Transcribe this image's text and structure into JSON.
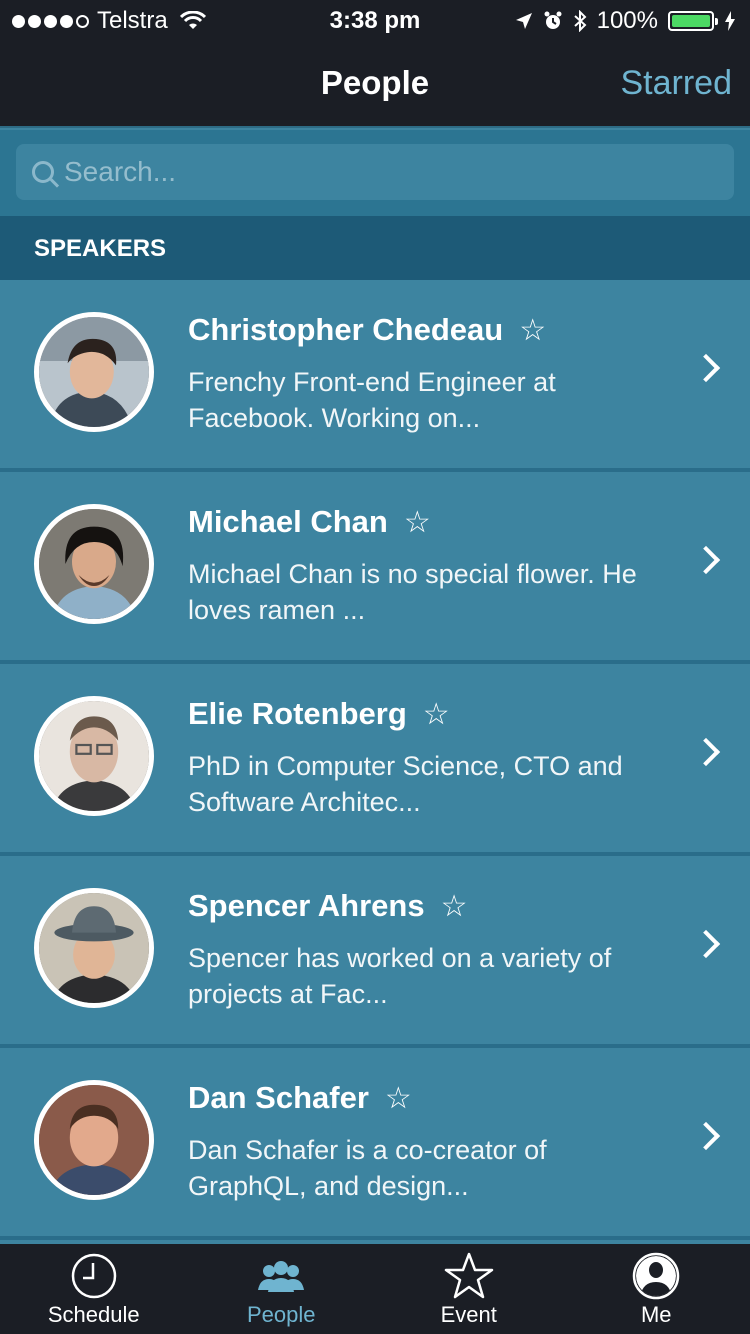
{
  "status": {
    "carrier": "Telstra",
    "time": "3:38 pm",
    "battery": "100%",
    "battery_level": 1.0
  },
  "nav": {
    "title": "People",
    "right_action": "Starred"
  },
  "search": {
    "placeholder": "Search..."
  },
  "section": {
    "title": "SPEAKERS"
  },
  "speakers": [
    {
      "name": "Christopher Chedeau",
      "bio": "Frenchy Front-end Engineer at Facebook. Working on...",
      "starred": false
    },
    {
      "name": "Michael Chan",
      "bio": "Michael Chan is no special flower. He loves ramen ...",
      "starred": false
    },
    {
      "name": "Elie Rotenberg",
      "bio": "PhD in Computer Science, CTO and Software Architec...",
      "starred": false
    },
    {
      "name": "Spencer Ahrens",
      "bio": "Spencer has worked on a variety of projects at Fac...",
      "starred": false
    },
    {
      "name": "Dan Schafer",
      "bio": "Dan Schafer is a co-creator of GraphQL, and design...",
      "starred": false
    }
  ],
  "tabs": [
    {
      "label": "Schedule",
      "icon": "clock-icon",
      "active": false
    },
    {
      "label": "People",
      "icon": "people-icon",
      "active": true
    },
    {
      "label": "Event",
      "icon": "star-icon",
      "active": false
    },
    {
      "label": "Me",
      "icon": "person-icon",
      "active": false
    }
  ],
  "colors": {
    "accent": "#6fb4d0",
    "bar_background": "#1b1e25",
    "row_background": "#3d84a0",
    "section_background": "#1d5a77"
  }
}
